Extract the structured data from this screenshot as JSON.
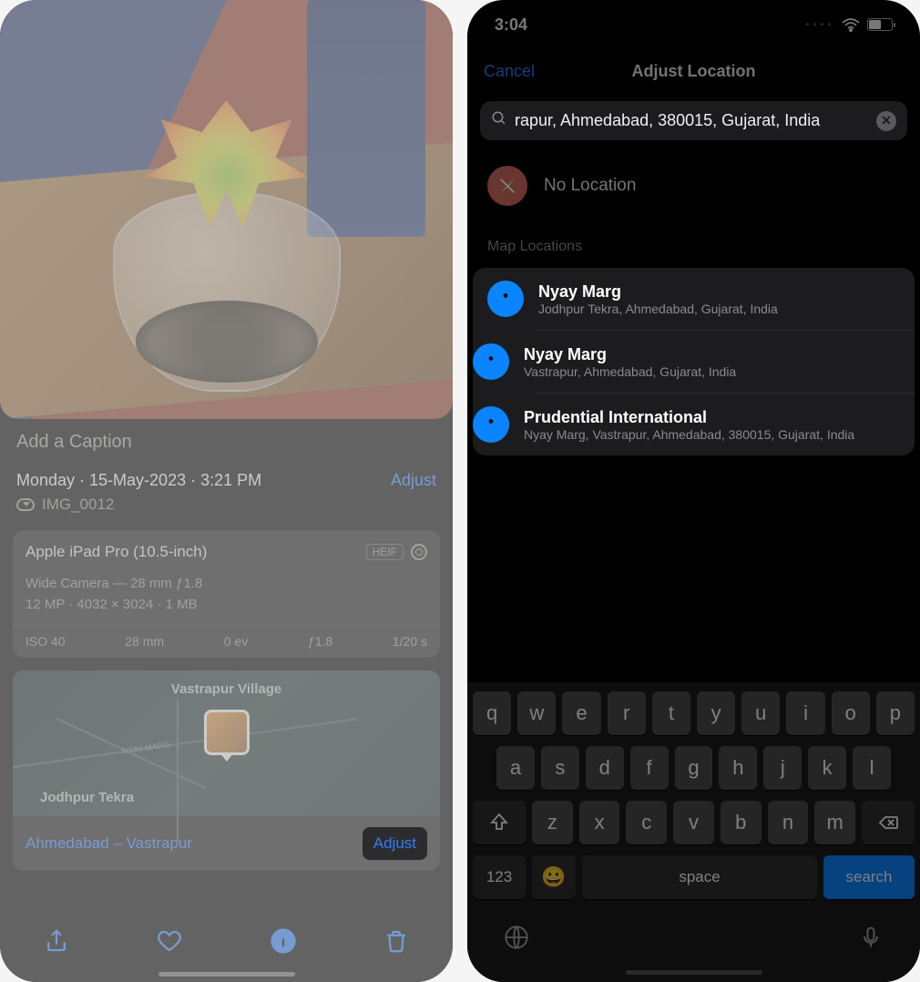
{
  "left": {
    "caption_placeholder": "Add a Caption",
    "meta_line": "Monday · 15-May-2023 · 3:21 PM",
    "adjust_link": "Adjust",
    "filename": "IMG_0012",
    "camera": {
      "device": "Apple iPad Pro (10.5-inch)",
      "format": "HEIF",
      "lens_line": "Wide Camera — 28 mm ƒ1.8",
      "specs_line": "12 MP · 4032 × 3024 · 1 MB",
      "iso": "ISO 40",
      "focal": "28 mm",
      "ev": "0 ev",
      "aperture": "ƒ1.8",
      "shutter": "1/20 s"
    },
    "map": {
      "label_village": "Vastrapur Village",
      "label_area": "Jodhpur Tekra",
      "road_name": "NYAY-MARG",
      "footer_location": "Ahmedabad – Vastrapur",
      "adjust_label": "Adjust"
    }
  },
  "right": {
    "time": "3:04",
    "cancel_label": "Cancel",
    "title": "Adjust Location",
    "search_value": "rapur, Ahmedabad, 380015, Gujarat, India",
    "no_location_label": "No Location",
    "section_header": "Map Locations",
    "results": [
      {
        "title": "Nyay Marg",
        "subtitle": "Jodhpur Tekra, Ahmedabad, Gujarat, India"
      },
      {
        "title": "Nyay Marg",
        "subtitle": "Vastrapur, Ahmedabad, Gujarat, India"
      },
      {
        "title": "Prudential International",
        "subtitle": "Nyay Marg, Vastrapur, Ahmedabad, 380015, Gujarat, India"
      }
    ],
    "keyboard": {
      "row1": [
        "q",
        "w",
        "e",
        "r",
        "t",
        "y",
        "u",
        "i",
        "o",
        "p"
      ],
      "row2": [
        "a",
        "s",
        "d",
        "f",
        "g",
        "h",
        "j",
        "k",
        "l"
      ],
      "row3": [
        "z",
        "x",
        "c",
        "v",
        "b",
        "n",
        "m"
      ],
      "num_key": "123",
      "space_key": "space",
      "search_key": "search"
    }
  }
}
